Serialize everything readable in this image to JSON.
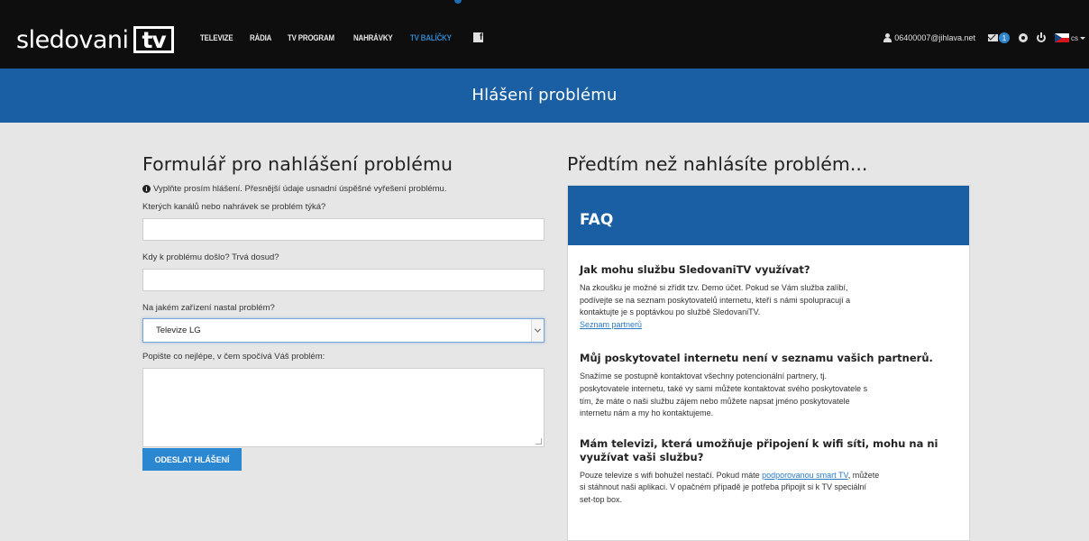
{
  "header": {
    "logo_text": "sledovani",
    "logo_box_text": "tv",
    "nav": [
      "TELEVIZE",
      "RÁDIA",
      "TV PROGRAM",
      "NAHRÁVKY",
      "TV BALÍČKY"
    ],
    "fb_icon_glyph": "f",
    "user_email": "06400007@jihlava.net",
    "messages_count": "1",
    "language": "cs",
    "accent_color": "#1a5ea3",
    "active_nav_color": "#2f86cc"
  },
  "band": {
    "title": "Hlášení problému"
  },
  "form": {
    "title": "Formulář pro nahlášení problému",
    "info": "Vyplňte prosím hlášení. Přesnější údaje usnadní úspěšné vyřešení problému.",
    "label_channels": "Kterých kanálů nebo nahrávek se problém týká?",
    "label_when": "Kdy k problému došlo? Trvá dosud?",
    "label_device": "Na jakém zařízení nastal problém?",
    "device_selected": "Televize LG",
    "label_description": "Popište co nejlépe, v čem spočívá Váš problém:",
    "submit": "ODESLAT HLÁŠENÍ"
  },
  "faq": {
    "heading": "Předtím než nahlásíte problém...",
    "title": "FAQ",
    "items": [
      {
        "q": "Jak mohu službu SledovaniTV využívat?",
        "a_lines": [
          "Na zkoušku je možné si zřídit tzv. Demo účet. Pokud se Vám služba zalíbí,",
          "podívejte se na seznam poskytovatelů internetu, kteří s námi spolupracují a",
          "kontaktujte je s poptávkou po službě SledovaniTV."
        ],
        "link": "Seznam partnerů"
      },
      {
        "q": "Můj poskytovatel internetu není v seznamu vašich partnerů.",
        "a_lines": [
          "Snažíme se postupně kontaktovat všechny potencionální partnery, tj.",
          "poskytovatele internetu, také vy sami můžete kontaktovat svého poskytovatele s",
          "tím, že máte o naši službu zájem nebo můžete napsat jméno poskytovatele",
          "internetu nám a my ho kontaktujeme."
        ]
      },
      {
        "q_lines": [
          "Mám televizi, která umožňuje připojení k wifi síti, mohu na ni",
          "využívat vaši službu?"
        ],
        "a_prefix": "Pouze televize s wifi bohužel nestačí. Pokud máte",
        "a_link": "podporovanou smart TV",
        "a_suffix": ", můžete",
        "a_lines": [
          "si stáhnout naši aplikaci. V opačném případě je potřeba připojit si k TV speciální",
          "set-top box."
        ]
      }
    ]
  }
}
